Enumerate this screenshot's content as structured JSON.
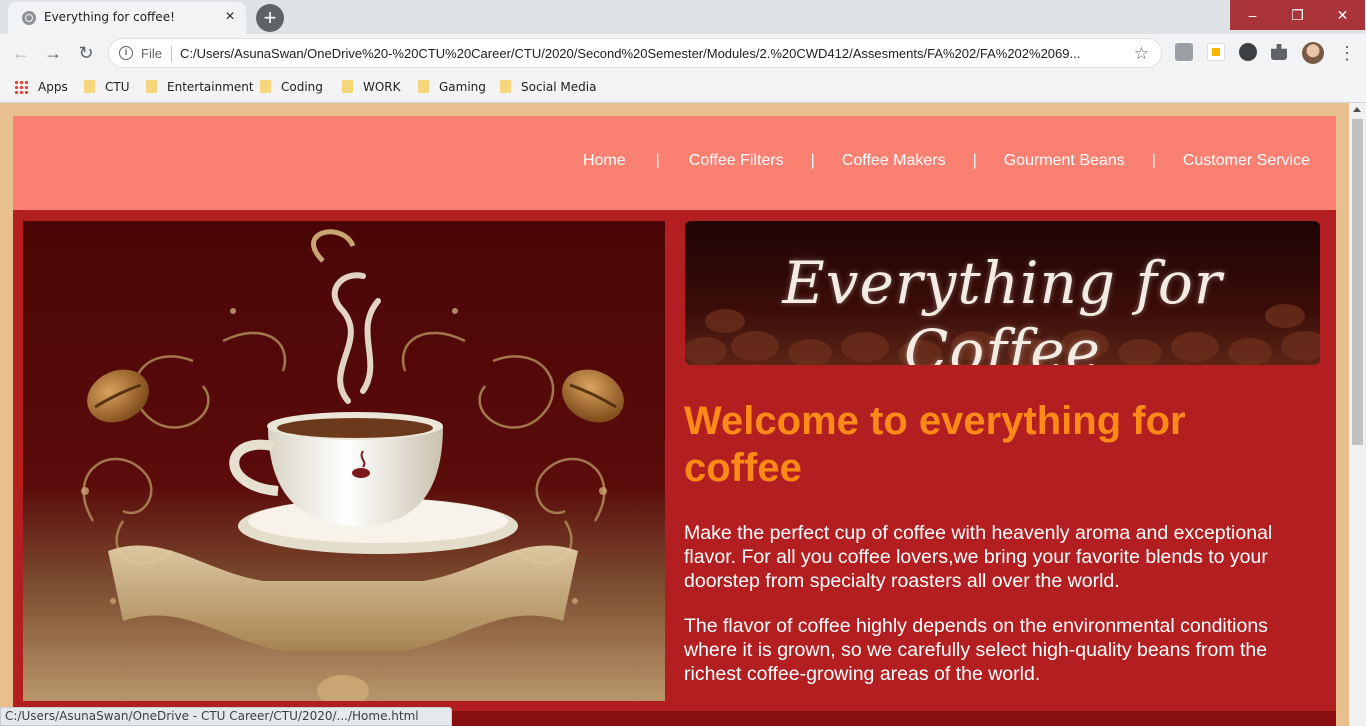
{
  "browser": {
    "tab": {
      "title": "Everything for coffee!",
      "close_glyph": "×"
    },
    "new_tab_glyph": "+",
    "window_controls": {
      "minimize": "–",
      "maximize": "❐",
      "close": "✕"
    },
    "address": {
      "scheme_label": "File",
      "url": "C:/Users/AsunaSwan/OneDrive%20-%20CTU%20Career/CTU/2020/Second%20Semester/Modules/2.%20CWD412/Assesments/FA%202/FA%202%2069..."
    },
    "bookmarks": [
      {
        "label": "Apps",
        "icon": "apps-grid-icon"
      },
      {
        "label": "CTU",
        "icon": "folder-icon"
      },
      {
        "label": "Entertainment",
        "icon": "folder-icon"
      },
      {
        "label": "Coding",
        "icon": "folder-icon"
      },
      {
        "label": "WORK",
        "icon": "folder-icon"
      },
      {
        "label": "Gaming",
        "icon": "folder-icon"
      },
      {
        "label": "Social Media",
        "icon": "folder-icon"
      }
    ],
    "status_url": "C:/Users/AsunaSwan/OneDrive - CTU Career/CTU/2020/.../Home.html"
  },
  "site": {
    "nav": {
      "items": [
        "Home",
        "Coffee Filters",
        "Coffee Makers",
        "Gourment Beans",
        "Customer Service"
      ],
      "separator": "|"
    },
    "banner_text": "Everything for Coffee",
    "heading": "Welcome to everything for coffee",
    "paragraphs": [
      "Make the perfect cup of coffee with heavenly aroma and exceptional flavor. For all you coffee lovers,we bring your favorite blends to your doorstep from specialty roasters all over the world.",
      "The flavor of coffee highly depends on the environmental conditions where it is grown, so we carefully select high-quality beans from the richest coffee-growing areas of the world."
    ],
    "colors": {
      "header_bg": "#fa8072",
      "body_bg": "#b31f21",
      "heading": "#ff8a18",
      "page_margin": "#e8c08d"
    }
  }
}
